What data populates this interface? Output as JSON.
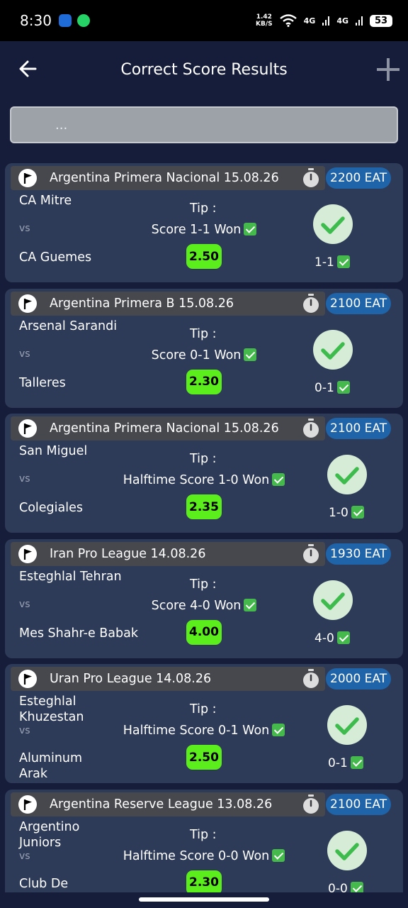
{
  "status_bar": {
    "time": "8:30",
    "speed": "1.42",
    "speed_unit": "KB/S",
    "signal1": "4G",
    "signal2": "4G",
    "battery": "53"
  },
  "header": {
    "title": "Correct Score Results"
  },
  "search": {
    "placeholder": "..."
  },
  "labels": {
    "vs": "vs",
    "tip": "Tip :"
  },
  "matches": [
    {
      "league": "Argentina Primera Nacional 15.08.26",
      "time": "2200 EAT",
      "home": "CA Mitre",
      "away": "CA Guemes",
      "tip": "Score 1-1 Won",
      "odds": "2.50",
      "result": "1-1"
    },
    {
      "league": "Argentina Primera B 15.08.26",
      "time": "2100 EAT",
      "home": "Arsenal Sarandi",
      "away": "Talleres",
      "tip": "Score 0-1 Won",
      "odds": "2.30",
      "result": "0-1"
    },
    {
      "league": "Argentina Primera Nacional 15.08.26",
      "time": "2100 EAT",
      "home": "San Miguel",
      "away": "Colegiales",
      "tip": "Halftime Score 1-0 Won",
      "odds": "2.35",
      "result": "1-0"
    },
    {
      "league": "Iran Pro League 14.08.26",
      "time": "1930 EAT",
      "home": "Esteghlal Tehran",
      "away": "Mes Shahr-e Babak",
      "tip": "Score 4-0 Won",
      "odds": "4.00",
      "result": "4-0"
    },
    {
      "league": "Uran Pro League 14.08.26",
      "time": "2000 EAT",
      "home": "Esteghlal Khuzestan",
      "away": "Aluminum Arak",
      "tip": "Halftime Score 0-1 Won",
      "odds": "2.50",
      "result": "0-1"
    },
    {
      "league": "Argentina Reserve League 13.08.26",
      "time": "2100 EAT",
      "home": "Argentino Juniors",
      "away": "Club De",
      "tip": "Halftime Score 0-0 Won",
      "odds": "2.30",
      "result": "0-0"
    }
  ],
  "colors": {
    "background": "#161d3a",
    "card": "#2e3b58",
    "card_header": "#47484d",
    "time_badge": "#1f64a8",
    "odds_badge": "#5cee1c",
    "check_circle": "#d6ecd6",
    "check_mark": "#3dbb4d"
  },
  "icons": {
    "back": "arrow-left-icon",
    "add": "plus-icon",
    "league": "flag-icon",
    "timer": "stopwatch-icon",
    "won": "check-circle-icon"
  }
}
